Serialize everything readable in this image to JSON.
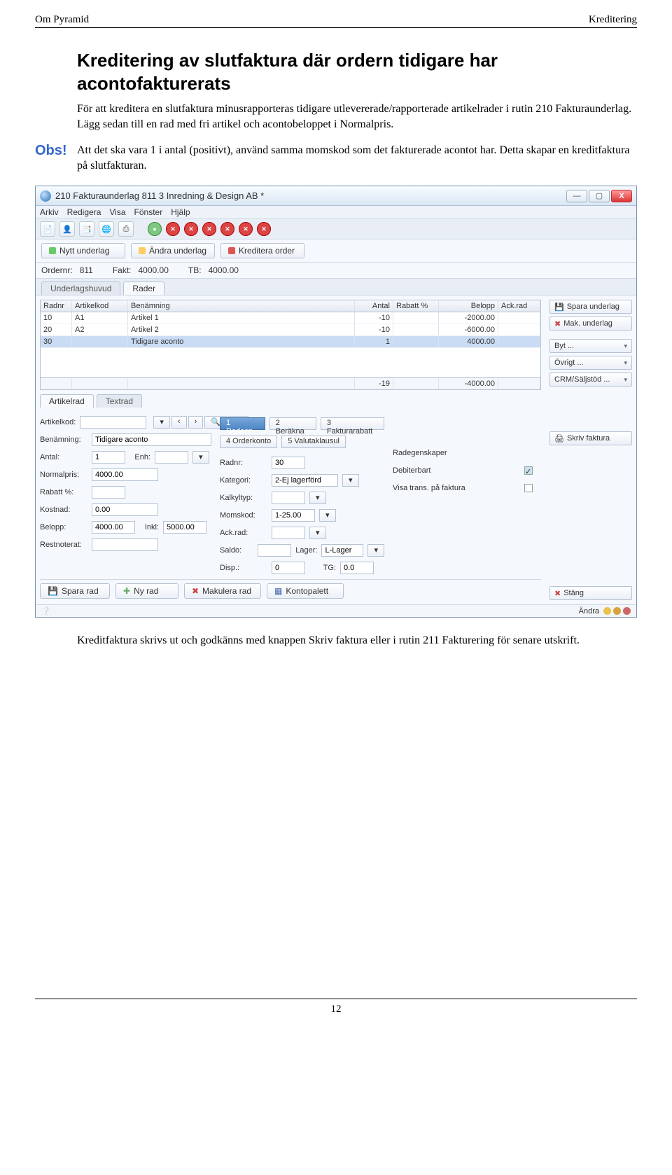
{
  "page_header": {
    "left": "Om Pyramid",
    "right": "Kreditering"
  },
  "heading": "Kreditering av slutfaktura där ordern tidigare har acontofakturerats",
  "intro": "För att kreditera en slutfaktura minusrapporteras tidigare utlevererade/rapporterade artikelrader i rutin 210 Fakturaunderlag. Lägg sedan till en rad med fri artikel och acontobeloppet i Normalpris.",
  "obs": {
    "label": "Obs!",
    "text": "Att det ska vara 1 i antal (positivt), använd samma momskod som det fakturerade acontot har. Detta skapar en kreditfaktura på slutfakturan."
  },
  "outro": "Kreditfaktura skrivs ut och godkänns med knappen Skriv faktura eller i rutin 211 Fakturering för senare utskrift.",
  "page_number": "12",
  "app": {
    "title": "210 Fakturaunderlag 811  3  Inredning & Design AB *",
    "menu": [
      "Arkiv",
      "Redigera",
      "Visa",
      "Fönster",
      "Hjälp"
    ],
    "actions": {
      "nytt": "Nytt underlag",
      "andra": "Ändra underlag",
      "kreditera": "Kreditera order"
    },
    "info": {
      "ordernr_label": "Ordernr:",
      "ordernr": "811",
      "fakt_label": "Fakt:",
      "fakt": "4000.00",
      "tb_label": "TB:",
      "tb": "4000.00"
    },
    "tabs": {
      "huvud": "Underlagshuvud",
      "rader": "Rader"
    },
    "grid": {
      "headers": {
        "radnr": "Radnr",
        "artkod": "Artikelkod",
        "benamn": "Benämning",
        "antal": "Antal",
        "rabatt": "Rabatt %",
        "belopp": "Belopp",
        "ack": "Ack.rad"
      },
      "rows": [
        {
          "radnr": "10",
          "artkod": "A1",
          "benamn": "Artikel 1",
          "antal": "-10",
          "rabatt": "",
          "belopp": "-2000.00",
          "ack": ""
        },
        {
          "radnr": "20",
          "artkod": "A2",
          "benamn": "Artikel 2",
          "antal": "-10",
          "rabatt": "",
          "belopp": "-6000.00",
          "ack": ""
        },
        {
          "radnr": "30",
          "artkod": "",
          "benamn": "Tidigare aconto",
          "antal": "1",
          "rabatt": "",
          "belopp": "4000.00",
          "ack": ""
        }
      ],
      "total": {
        "antal": "-19",
        "belopp": "-4000.00"
      }
    },
    "side": {
      "spara": "Spara underlag",
      "mak": "Mak. underlag",
      "byt": "Byt ...",
      "ovrigt": "Övrigt ...",
      "crm": "CRM/Säljstöd ...",
      "skriv": "Skriv faktura",
      "stang": "Stäng"
    },
    "subtabs": {
      "artikelrad": "Artikelrad",
      "textrad": "Textrad"
    },
    "midbtns": {
      "radegn": "1 Radegn",
      "berakna": "2 Beräkna",
      "frabatt": "3 Fakturarabatt",
      "orderkonto": "4 Orderkonto",
      "valuta": "5 Valutaklausul"
    },
    "form": {
      "artikelkod_l": "Artikelkod:",
      "artikelkod": "",
      "benamn_l": "Benämning:",
      "benamn": "Tidigare aconto",
      "antal_l": "Antal:",
      "antal": "1",
      "enh_l": "Enh:",
      "enh": "",
      "normalpris_l": "Normalpris:",
      "normalpris": "4000.00",
      "rabatt_l": "Rabatt %:",
      "rabatt": "",
      "kostnad_l": "Kostnad:",
      "kostnad": "0.00",
      "belopp_l": "Belopp:",
      "belopp": "4000.00",
      "inkl_l": "Inkl:",
      "inkl": "5000.00",
      "restnot_l": "Restnoterat:",
      "restnot": "",
      "radnr_l": "Radnr:",
      "radnr": "30",
      "kategori_l": "Kategori:",
      "kategori": "2-Ej lagerförd",
      "kalkyltyp_l": "Kalkyltyp:",
      "kalkyltyp": "",
      "momskod_l": "Momskod:",
      "momskod": "1-25.00",
      "ackrad_l": "Ack.rad:",
      "ackrad": "",
      "saldo_l": "Saldo:",
      "saldo": "",
      "lager_l": "Lager:",
      "lager": "L-Lager",
      "disp_l": "Disp.:",
      "disp": "0",
      "tg_l": "TG:",
      "tg": "0.0",
      "radegenskaper": "Radegenskaper",
      "debiterbart": "Debiterbart",
      "visatrans": "Visa trans. på faktura"
    },
    "bottom": {
      "spara_rad": "Spara rad",
      "ny_rad": "Ny rad",
      "makulera_rad": "Makulera rad",
      "kontopalett": "Kontopalett"
    },
    "status": "Ändra"
  }
}
